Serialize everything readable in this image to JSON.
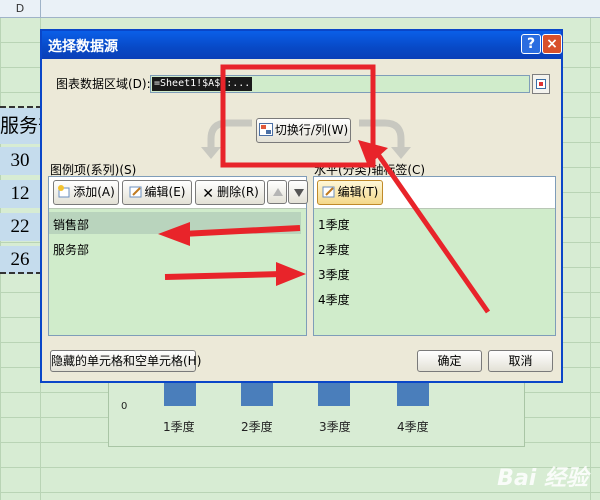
{
  "sheet": {
    "column_letter_d": "D",
    "dept_partial": "服务部",
    "values": [
      "30",
      "12",
      "22",
      "26"
    ]
  },
  "chart": {
    "y_tick": "0",
    "categories": [
      "1季度",
      "2季度",
      "3季度",
      "4季度"
    ]
  },
  "dialog": {
    "title": "选择数据源",
    "help_glyph": "?",
    "close_glyph": "×",
    "range_label": "图表数据区域(D):",
    "range_value": "=Sheet1!$A$3:...",
    "switch_button": "切换行/列(W)",
    "series_label": "图例项(系列)(S)",
    "axis_label": "水平(分类)轴标签(C)",
    "add_button": "添加(A)",
    "edit_button": "编辑(E)",
    "delete_button": "删除(R)",
    "axis_edit_button": "编辑(T)",
    "series": [
      "销售部",
      "服务部"
    ],
    "axis_items": [
      "1季度",
      "2季度",
      "3季度",
      "4季度"
    ],
    "hidden_button": "隐藏的单元格和空单元格(H)",
    "ok_button": "确定",
    "cancel_button": "取消"
  },
  "colors": {
    "annotation_red": "#e8242a",
    "titlebar_blue": "#0a5fe8",
    "list_background": "#d0eccb"
  },
  "watermark": "Bai 经验"
}
